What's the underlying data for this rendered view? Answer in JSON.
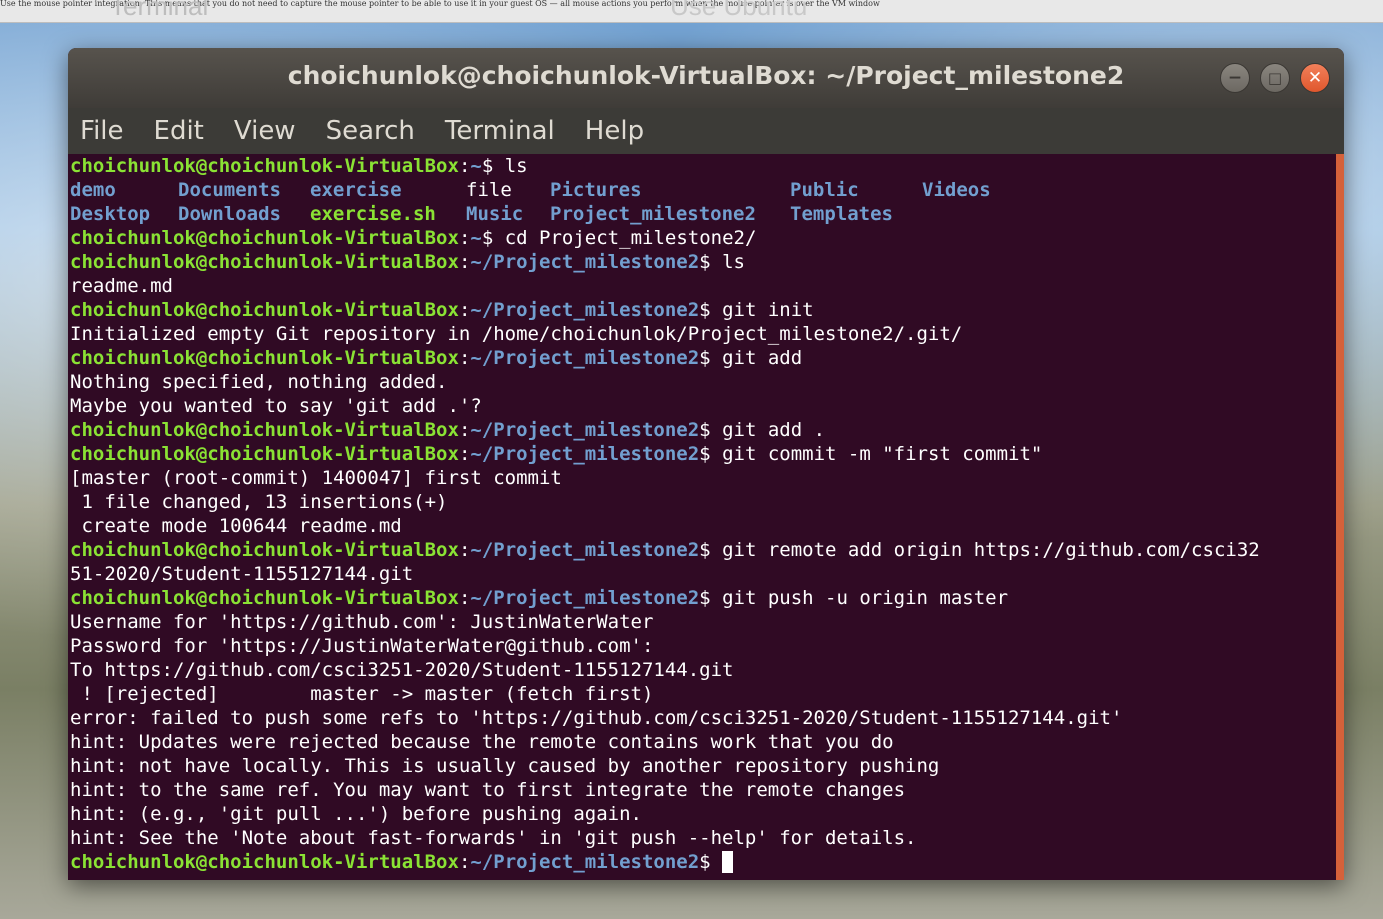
{
  "background_strip": {
    "text": "Use the mouse pointer integration: This means that you do not need to capture the mouse pointer to be able to use it in your guest OS — all mouse actions you perform when the mouse pointer is over the VM window",
    "ghost_left": "Terminal",
    "ghost_mid": "Use Ubuntu"
  },
  "window": {
    "title": "choichunlok@choichunlok-VirtualBox: ~/Project_milestone2",
    "buttons": {
      "minimize": "−",
      "maximize": "□",
      "close": "✕"
    }
  },
  "menu": [
    "File",
    "Edit",
    "View",
    "Search",
    "Terminal",
    "Help"
  ],
  "prompt": {
    "user_host": "choichunlok@choichunlok-VirtualBox",
    "home": "~",
    "project": "~/Project_milestone2"
  },
  "terminal": {
    "cmd1": "ls",
    "ls_row1": [
      "demo",
      "Documents",
      "exercise",
      "file",
      "Pictures",
      "Public",
      "Videos"
    ],
    "ls_row2": [
      "Desktop",
      "Downloads",
      "exercise.sh",
      "Music",
      "Project_milestone2",
      "Templates"
    ],
    "cmd2": "cd Project_milestone2/",
    "cmd3": "ls",
    "out3": "readme.md",
    "cmd4": "git init",
    "out4": "Initialized empty Git repository in /home/choichunlok/Project_milestone2/.git/",
    "cmd5": "git add",
    "out5a": "Nothing specified, nothing added.",
    "out5b": "Maybe you wanted to say 'git add .'?",
    "cmd6": "git add .",
    "cmd7": "git commit -m \"first commit\"",
    "out7a": "[master (root-commit) 1400047] first commit",
    "out7b": " 1 file changed, 13 insertions(+)",
    "out7c": " create mode 100644 readme.md",
    "cmd8": "git remote add origin https://github.com/csci32",
    "cmd8_wrap": "51-2020/Student-1155127144.git",
    "cmd9": "git push -u origin master",
    "out9a": "Username for 'https://github.com': JustinWaterWater",
    "out9b": "Password for 'https://JustinWaterWater@github.com':",
    "out9c": "To https://github.com/csci3251-2020/Student-1155127144.git",
    "out9d": " ! [rejected]        master -> master (fetch first)",
    "out9e": "error: failed to push some refs to 'https://github.com/csci3251-2020/Student-1155127144.git'",
    "out9f": "hint: Updates were rejected because the remote contains work that you do",
    "out9g": "hint: not have locally. This is usually caused by another repository pushing",
    "out9h": "hint: to the same ref. You may want to first integrate the remote changes",
    "out9i": "hint: (e.g., 'git pull ...') before pushing again.",
    "out9j": "hint: See the 'Note about fast-forwards' in 'git push --help' for details."
  },
  "colors": {
    "terminal_bg": "#300a24",
    "prompt_user": "#8ae234",
    "prompt_path": "#729fcf",
    "scrollbar": "#d5613a"
  }
}
